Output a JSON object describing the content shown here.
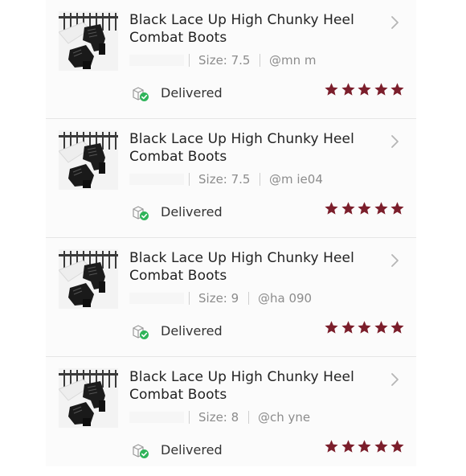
{
  "colors": {
    "star": "#7b1e2b",
    "delivered_check": "#2fb45a",
    "text_primary": "#222222",
    "text_muted": "#8c8c8c"
  },
  "orders": [
    {
      "title": "Black Lace Up High Chunky Heel Combat Boots",
      "size": "Size: 7.5",
      "user": "@mn     m",
      "status": "Delivered",
      "rating": 5,
      "status_icon": "package-delivered-icon",
      "star_icon": "star-icon",
      "chevron_icon": "chevron-right-icon"
    },
    {
      "title": "Black Lace Up High Chunky Heel Combat Boots",
      "size": "Size: 7.5",
      "user": "@m          ie04",
      "status": "Delivered",
      "rating": 5,
      "status_icon": "package-delivered-icon",
      "star_icon": "star-icon",
      "chevron_icon": "chevron-right-icon"
    },
    {
      "title": "Black Lace Up High Chunky Heel Combat Boots",
      "size": "Size: 9",
      "user": "@ha      090",
      "status": "Delivered",
      "rating": 5,
      "status_icon": "package-delivered-icon",
      "star_icon": "star-icon",
      "chevron_icon": "chevron-right-icon"
    },
    {
      "title": "Black Lace Up High Chunky Heel Combat Boots",
      "size": "Size: 8",
      "user": "@ch          yne",
      "status": "Delivered",
      "rating": 5,
      "status_icon": "package-delivered-icon",
      "star_icon": "star-icon",
      "chevron_icon": "chevron-right-icon"
    }
  ]
}
